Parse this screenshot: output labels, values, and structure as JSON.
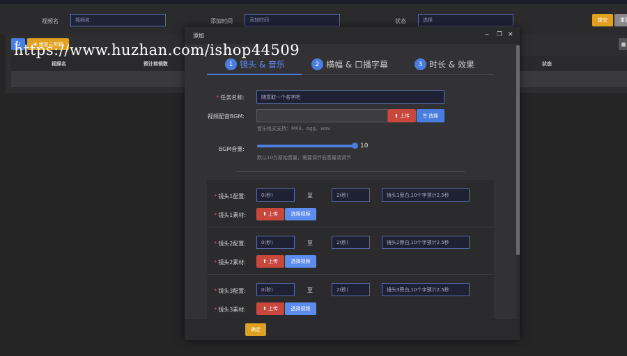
{
  "filter": {
    "video_name_label": "视频名",
    "video_name_placeholder": "视频名",
    "add_time_label": "添加时间",
    "add_time_placeholder": "添加时间",
    "status_label": "状态",
    "status_value": "选择",
    "submit_label": "提交",
    "reset_label": "重置"
  },
  "toolbar": {
    "refresh_icon": "↻",
    "add_label": "添加云剪辑"
  },
  "table": {
    "col_video_name": "视频名",
    "col_estimate": "预计剪辑数",
    "col_status": "状态"
  },
  "watermark": "https://www.huzhan.com/ishop44509",
  "modal": {
    "title": "添加",
    "steps": [
      {
        "num": "1",
        "label": "镜头 & 音乐"
      },
      {
        "num": "2",
        "label": "横幅 & 口播字幕"
      },
      {
        "num": "3",
        "label": "时长 & 效果"
      }
    ],
    "task_name_label": "任务名称:",
    "task_name_value": "随意取一个名字吧",
    "bgm_label": "视频配音BGM:",
    "upload_label": "上传",
    "select_label": "选择",
    "bgm_hint": "音乐格式支持：MP3、ogg、wav",
    "volume_label": "BGM音量:",
    "volume_value": "10",
    "volume_hint": "默认10为原始音量，需要调节低音量请调节",
    "shots": [
      {
        "config_label": "镜头1配置:",
        "start": "0(秒)",
        "to": "至",
        "end": "2(秒)",
        "desc": "镜头1旁白,10个字预计2.5秒",
        "material_label": "镜头1素材:",
        "upload": "上传",
        "select": "选择视频"
      },
      {
        "config_label": "镜头2配置:",
        "start": "0(秒)",
        "to": "至",
        "end": "2(秒)",
        "desc": "镜头2旁白,10个字预计2.5秒",
        "material_label": "镜头2素材:",
        "upload": "上传",
        "select": "选择视频"
      },
      {
        "config_label": "镜头3配置:",
        "start": "0(秒)",
        "to": "至",
        "end": "2(秒)",
        "desc": "镜头3旁白,10个字预计2.5秒",
        "material_label": "镜头3素材:",
        "upload": "上传",
        "select": "选择视频"
      }
    ],
    "confirm_label": "确定"
  },
  "colors": {
    "accent_blue": "#4a7de0",
    "upload_red": "#c9473d",
    "warning_orange": "#e0a020",
    "input_border": "#5a6ba8"
  }
}
